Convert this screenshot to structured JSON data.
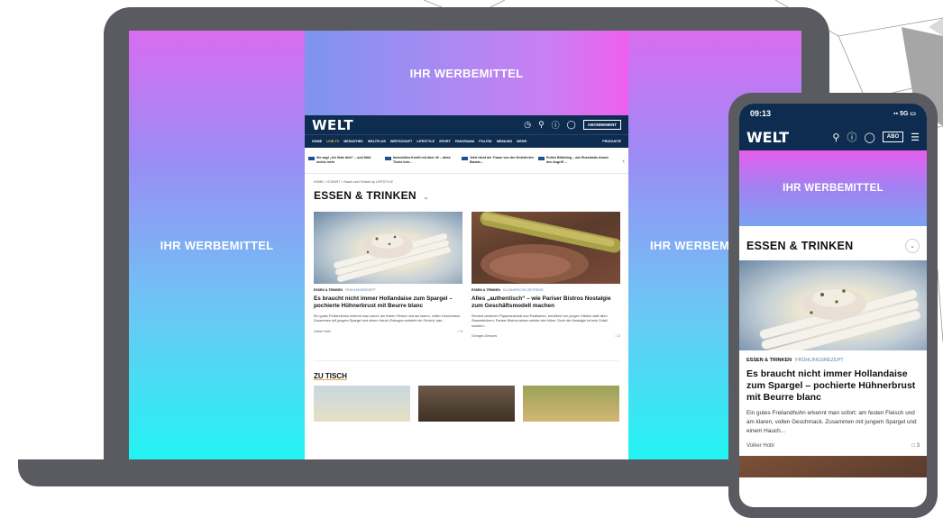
{
  "ads": {
    "label": "IHR WERBEMITTEL"
  },
  "desktop": {
    "logo": "WELT",
    "abo_button": "ABONNEMENT",
    "nav": [
      "HOME",
      "LIVE-TV",
      "MEDIATHEK",
      "WELTPLUS",
      "WIRTSCHAFT",
      "LIFESTYLE",
      "SPORT",
      "PANORAMA",
      "POLITIK",
      "MEINUNG",
      "MEHR",
      "PRODUKTE"
    ],
    "ticker": [
      "Sie sagt „Ich liebe dich“ – und fühlt nichts mehr",
      "Immobilien-Kredit mit über 40 – diese Tricks brin...",
      "Jetzt rächt der Traum von der fehlerfreien Bauste...",
      "Putins Blitzkrieg – wie Russlands Armee den Angriff ..."
    ],
    "breadcrumb": "HOME  >  ICONIST  >  Essen und Trinken by LIFESTYLE",
    "section_title": "ESSEN & TRINKEN",
    "articles": [
      {
        "tag": "ESSEN & TRINKEN",
        "subtag": "FRÜHLINGSREZEPT",
        "title": "Es braucht nicht immer Hollandaise zum Spargel – pochierte Hühnerbrust mit Beurre blanc",
        "summary": "Ein gutes Freilandhuhn erkennt man sofort: am festen Fleisch und am klaren, vollen Geschmack. Zusammen mit jungem Spargel und einem Hauch Estragon entsteht ein Gericht, das...",
        "author": "Volker Hobl",
        "comments": "3"
      },
      {
        "tag": "ESSEN & TRINKEN",
        "subtag": "KULINARISCHE ZEITREISE",
        "title": "Alles „authentisch“ – wie Pariser Bistros Nostalgie zum Geschäftsmodell machen",
        "summary": "Serviert zwischen Flipperautomat und Postkarten, bevölkert von jungen Gästen statt alten Stammtrinkern: Pariser Bistros wirken wieder wie früher. Doch die Nostalgie ist kein Zufall, sondern...",
        "author": "Georges Desrues",
        "comments": "2"
      }
    ],
    "subsection_title": "ZU TISCH"
  },
  "mobile": {
    "time": "09:13",
    "network": "5G",
    "logo": "WELT",
    "abo_button": "ABO",
    "section_title": "ESSEN & TRINKEN",
    "article": {
      "tag": "ESSEN & TRINKEN",
      "subtag": "FRÜHLINGSREZEPT",
      "title": "Es braucht nicht immer Hollandaise zum Spargel – pochierte Hühnerbrust mit Beurre blanc",
      "summary": "Ein gutes Freilandhuhn erkennt man sofort: am festen Fleisch und am klaren, vollen Geschmack. Zusammen mit jungem Spargel und einem Hauch...",
      "author": "Volker Hobl",
      "comments": "3"
    }
  },
  "colors": {
    "welt_navy": "#0e2c4f",
    "ad_cyan": "#22f4f2",
    "ad_magenta": "#ef5fef",
    "device_gray": "#595b60"
  }
}
